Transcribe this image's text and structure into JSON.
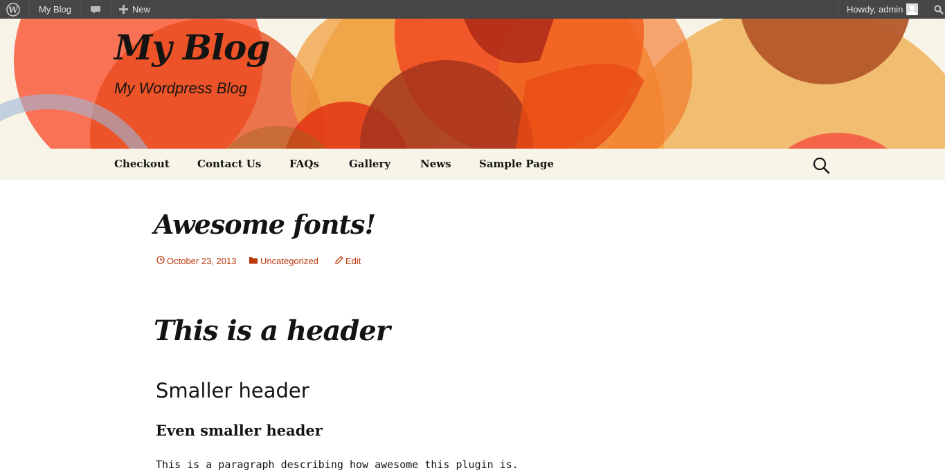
{
  "admin_bar": {
    "wp_logo_icon": "wordpress-logo-icon",
    "site_name": "My Blog",
    "comments_icon": "speech-bubble-icon",
    "new_label": "New",
    "new_icon": "plus-icon",
    "greeting": "Howdy, admin",
    "avatar_icon": "user-avatar-icon",
    "search_icon": "search-icon"
  },
  "header": {
    "site_title": "My Blog",
    "site_description": "My Wordpress Blog"
  },
  "nav": {
    "items": [
      "Checkout",
      "Contact Us",
      "FAQs",
      "Gallery",
      "News",
      "Sample Page"
    ],
    "search_icon": "search-icon"
  },
  "post": {
    "title": "Awesome fonts!",
    "meta": {
      "date": "October 23, 2013",
      "category": "Uncategorized",
      "edit": "Edit"
    },
    "heading1": "This is a header",
    "heading2": "Smaller header",
    "heading3": "Even smaller header",
    "paragraph": "This is a paragraph describing how awesome this plugin is."
  },
  "colors": {
    "admin_bar_bg": "#464646",
    "header_bg": "#f7f3e7",
    "nav_bg": "#f7f5e7",
    "link_accent": "#bc360a",
    "text": "#141412"
  }
}
